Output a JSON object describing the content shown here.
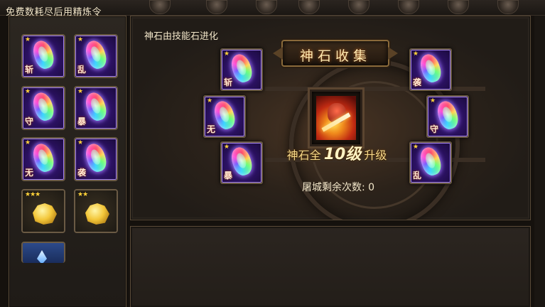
{
  "left_panel": {
    "title": "免费数耗尽后用精炼令",
    "items": [
      {
        "type": "skill-stone",
        "star": "★",
        "glyph": "斩"
      },
      {
        "type": "skill-stone",
        "star": "★",
        "glyph": "乱"
      },
      {
        "type": "skill-stone",
        "star": "★",
        "glyph": "守"
      },
      {
        "type": "skill-stone",
        "star": "★",
        "glyph": "暴"
      },
      {
        "type": "skill-stone",
        "star": "★",
        "glyph": "无"
      },
      {
        "type": "skill-stone",
        "star": "★",
        "glyph": "袭"
      },
      {
        "type": "gold-ore",
        "stars": "★★★"
      },
      {
        "type": "gold-ore",
        "stars": "★★"
      },
      {
        "type": "blue-crystal"
      }
    ]
  },
  "main_panel": {
    "title": "神石由技能石进化",
    "banner": "神石收集",
    "upgrade_prefix": "神石全",
    "upgrade_level": "10级",
    "upgrade_suffix": "升级",
    "remaining_label": "屠城剩余次数: 0",
    "stones": {
      "left_top": {
        "star": "★",
        "glyph": "斩"
      },
      "left_mid": {
        "star": "★",
        "glyph": "无"
      },
      "left_bottom": {
        "star": "★",
        "glyph": "暴"
      },
      "right_top": {
        "star": "★",
        "glyph": "袭"
      },
      "right_mid": {
        "star": "★",
        "glyph": "守"
      },
      "right_bottom": {
        "star": "★",
        "glyph": "乱"
      }
    }
  },
  "colors": {
    "accent_gold": "#f7d98a",
    "panel_border": "#5a4b38",
    "stone_purple": "#2a1160"
  }
}
